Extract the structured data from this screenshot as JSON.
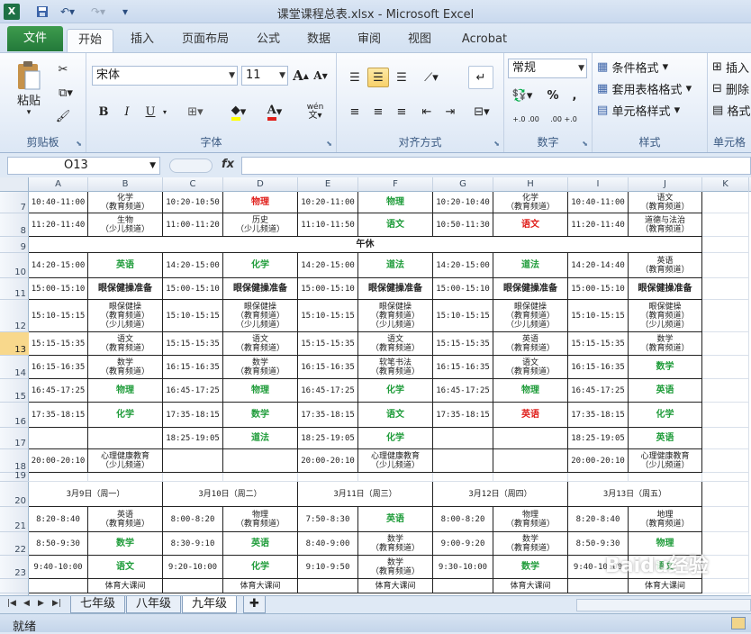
{
  "window": {
    "title": "课堂课程总表.xlsx - Microsoft Excel"
  },
  "qat": {
    "app_icon": "X"
  },
  "tabs": [
    {
      "label": "文件"
    },
    {
      "label": "开始"
    },
    {
      "label": "插入"
    },
    {
      "label": "页面布局"
    },
    {
      "label": "公式"
    },
    {
      "label": "数据"
    },
    {
      "label": "审阅"
    },
    {
      "label": "视图"
    },
    {
      "label": "Acrobat"
    }
  ],
  "ribbon": {
    "clipboard": {
      "paste": "粘贴",
      "label": "剪贴板"
    },
    "font": {
      "name": "宋体",
      "size": "11",
      "bold": "B",
      "italic": "I",
      "underline": "U",
      "label": "字体",
      "grow": "A",
      "shrink": "A",
      "wen": "wén"
    },
    "align": {
      "label": "对齐方式"
    },
    "number": {
      "format": "常规",
      "percent": "%",
      "comma": ",",
      "inc": "+.0 .00",
      "dec": ".00 +.0",
      "label": "数字"
    },
    "styles": {
      "cond": "条件格式",
      "table": "套用表格格式",
      "cell": "单元格样式",
      "label": "样式"
    },
    "cells": {
      "insert": "插入",
      "delete": "删除",
      "format": "格式",
      "label": "单元格"
    }
  },
  "formula": {
    "namebox": "O13",
    "fx": "fx",
    "value": ""
  },
  "columns": [
    "A",
    "B",
    "C",
    "D",
    "E",
    "F",
    "G",
    "H",
    "I",
    "J",
    "K"
  ],
  "rows": [
    "7",
    "8",
    "9",
    "10",
    "11",
    "12",
    "13",
    "14",
    "15",
    "16",
    "17",
    "18",
    "19",
    "20",
    "21",
    "22",
    "23"
  ],
  "cells": {
    "r7": [
      "10:40-11:00",
      "化学\n（教育频道）",
      "10:20-10:50",
      "物理",
      "10:20-11:00",
      "物理",
      "10:20-10:40",
      "化学\n（教育频道）",
      "10:40-11:00",
      "语文\n（教育频道）"
    ],
    "r8": [
      "11:20-11:40",
      "生物\n（少儿频道）",
      "11:00-11:20",
      "历史\n（少儿频道）",
      "11:10-11:50",
      "语文",
      "10:50-11:30",
      "语文",
      "11:20-11:40",
      "道德与法治\n（教育频道）"
    ],
    "r9": "午休",
    "r10": [
      "14:20-15:00",
      "英语",
      "14:20-15:00",
      "化学",
      "14:20-15:00",
      "道法",
      "14:20-15:00",
      "道法",
      "14:20-14:40",
      "英语\n（教育频道）"
    ],
    "r11": [
      "15:00-15:10",
      "眼保健操准备",
      "15:00-15:10",
      "眼保健操准备",
      "15:00-15:10",
      "眼保健操准备",
      "15:00-15:10",
      "眼保健操准备",
      "15:00-15:10",
      "眼保健操准备"
    ],
    "r12": [
      "15:10-15:15",
      "眼保健操\n（教育频道）\n（少儿频道）",
      "15:10-15:15",
      "眼保健操\n（教育频道）\n（少儿频道）",
      "15:10-15:15",
      "眼保健操\n（教育频道）\n（少儿频道）",
      "15:10-15:15",
      "眼保健操\n（教育频道）\n（少儿频道）",
      "15:10-15:15",
      "眼保健操\n（教育频道）\n（少儿频道）"
    ],
    "r13": [
      "15:15-15:35",
      "语文\n（教育频道）",
      "15:15-15:35",
      "语文\n（教育频道）",
      "15:15-15:35",
      "语文\n（教育频道）",
      "15:15-15:35",
      "英语\n（教育频道）",
      "15:15-15:35",
      "数学\n（教育频道）"
    ],
    "r14": [
      "16:15-16:35",
      "数学\n（教育频道）",
      "16:15-16:35",
      "数学\n（教育频道）",
      "16:15-16:35",
      "软笔书法\n（教育频道）",
      "16:15-16:35",
      "语文\n（教育频道）",
      "16:15-16:35",
      "数学"
    ],
    "r15": [
      "16:45-17:25",
      "物理",
      "16:45-17:25",
      "物理",
      "16:45-17:25",
      "化学",
      "16:45-17:25",
      "物理",
      "16:45-17:25",
      "英语"
    ],
    "r16": [
      "17:35-18:15",
      "化学",
      "17:35-18:15",
      "数学",
      "17:35-18:15",
      "语文",
      "17:35-18:15",
      "英语",
      "17:35-18:15",
      "化学"
    ],
    "r17": [
      "",
      "",
      "18:25-19:05",
      "道法",
      "18:25-19:05",
      "化学",
      "",
      "",
      "18:25-19:05",
      "英语"
    ],
    "r18": [
      "20:00-20:10",
      "心理健康教育\n（少儿频道）",
      "",
      "",
      "20:00-20:10",
      "心理健康教育\n（少儿频道）",
      "",
      "",
      "20:00-20:10",
      "心理健康教育\n（少儿频道）"
    ],
    "r20": [
      "3月9日（周一）",
      "3月10日（周二）",
      "3月11日（周三）",
      "3月12日（周四）",
      "3月13日（周五）"
    ],
    "r21": [
      "8:20-8:40",
      "英语\n（教育频道）",
      "8:00-8:20",
      "物理\n（教育频道）",
      "7:50-8:30",
      "英语",
      "8:00-8:20",
      "物理\n（教育频道）",
      "8:20-8:40",
      "地理\n（教育频道）"
    ],
    "r22": [
      "8:50-9:30",
      "数学",
      "8:30-9:10",
      "英语",
      "8:40-9:00",
      "数学\n（教育频道）",
      "9:00-9:20",
      "数学\n（教育频道）",
      "8:50-9:30",
      "物理"
    ],
    "r23": [
      "9:40-10:00",
      "语文",
      "9:20-10:00",
      "化学",
      "9:10-9:50",
      "数学\n（教育频道）",
      "9:30-10:00",
      "数学",
      "9:40-10:00",
      "语文"
    ],
    "r24": [
      "",
      "体育大课间",
      "",
      "体育大课间",
      "",
      "体育大课间",
      "",
      "体育大课间",
      "",
      "体育大课间"
    ]
  },
  "sheets": [
    "七年级",
    "八年级",
    "九年级"
  ],
  "status": {
    "ready": "就绪"
  },
  "watermark": "Baidu经验"
}
